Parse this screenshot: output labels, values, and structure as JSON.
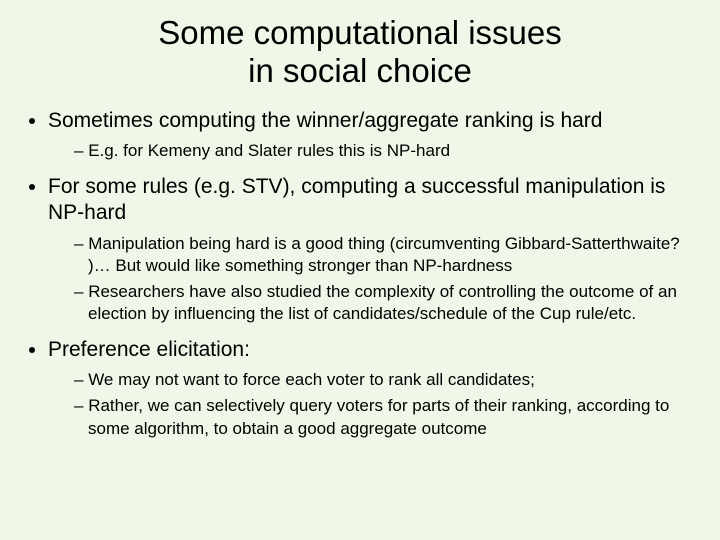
{
  "title_line1": "Some computational issues",
  "title_line2": "in social choice",
  "bullets": {
    "b1": "Sometimes computing the winner/aggregate ranking is hard",
    "b1_sub1": "E.g. for Kemeny and Slater rules this is NP-hard",
    "b2": "For some rules (e.g. STV), computing a successful manipulation is NP-hard",
    "b2_sub1": "Manipulation being hard is a good thing (circumventing Gibbard-Satterthwaite? )… But would like something stronger than NP-hardness",
    "b2_sub2": "Researchers have also studied the complexity of controlling the outcome of an election by influencing the list of candidates/schedule of the Cup rule/etc.",
    "b3": "Preference elicitation:",
    "b3_sub1": "We may not want to force each voter to rank all candidates;",
    "b3_sub2": "Rather, we can selectively query voters for parts of their ranking, according to some algorithm, to obtain a good aggregate outcome"
  }
}
